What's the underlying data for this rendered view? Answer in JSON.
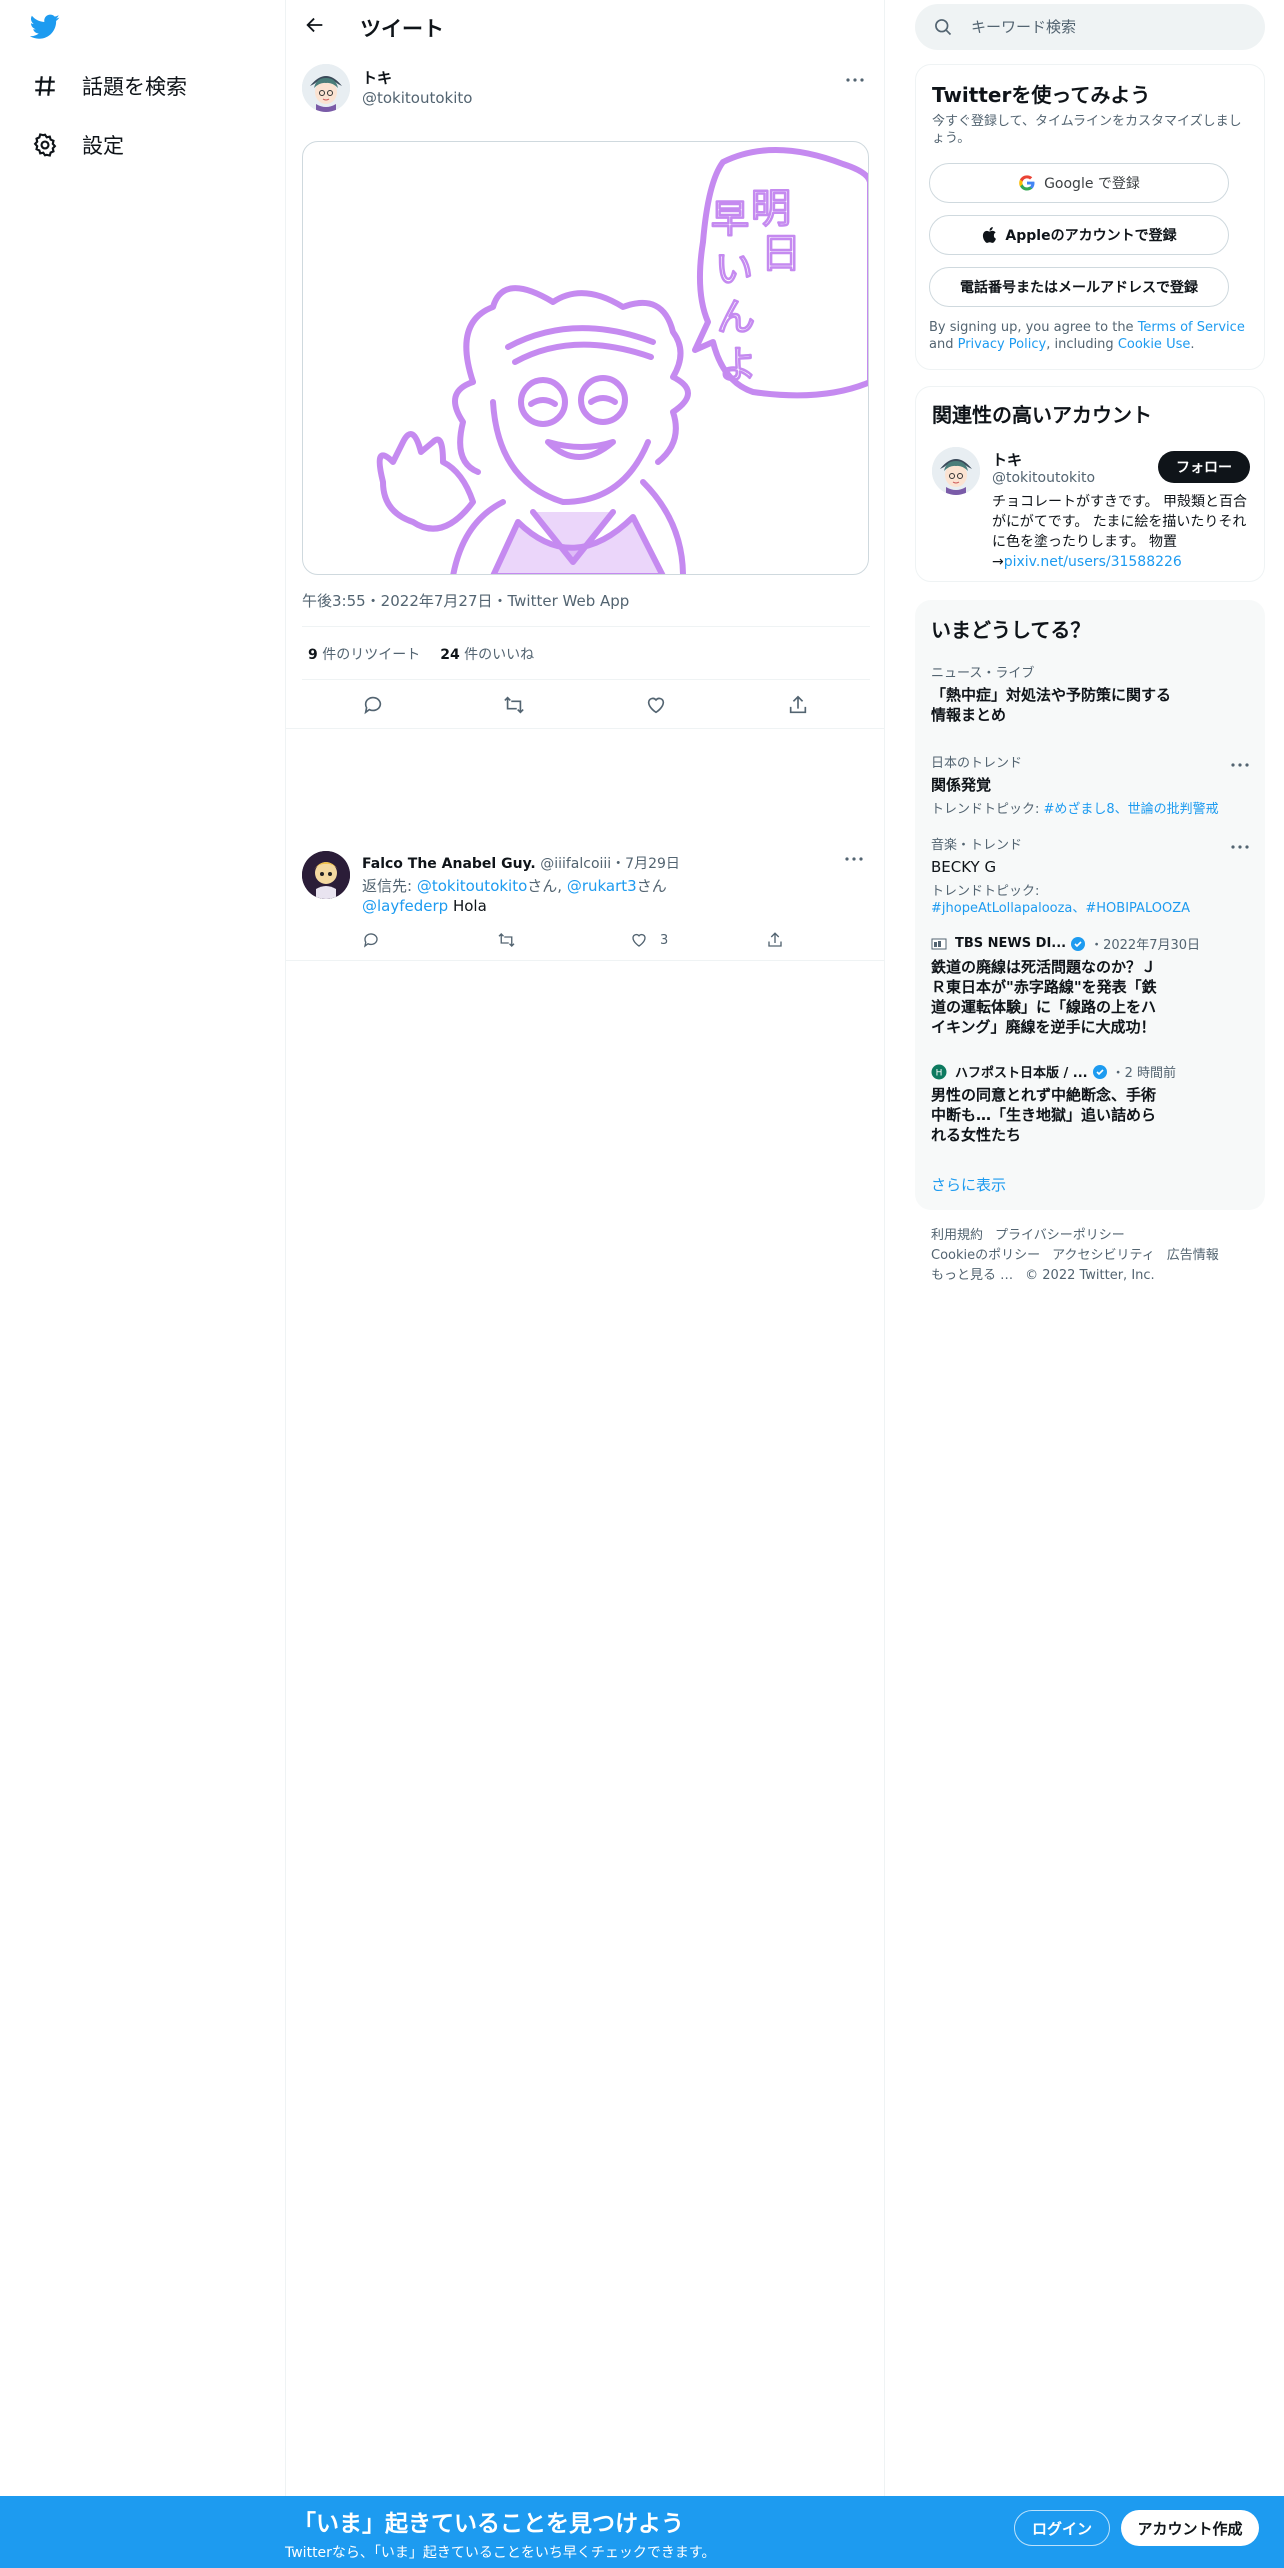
{
  "nav": {
    "logo": "twitter-bird-icon",
    "items": [
      {
        "label": "話題を検索",
        "icon": "hash-icon"
      },
      {
        "label": "設定",
        "icon": "gear-icon"
      }
    ]
  },
  "header": {
    "title": "ツイート"
  },
  "tweet": {
    "name": "トキ",
    "handle": "@tokitoutokito",
    "image_text": "明日早いんよ",
    "timestamp": "午後3:55・2022年7月27日・Twitter Web App",
    "retweets": "9",
    "retweets_label": "件のリツイート",
    "likes": "24",
    "likes_label": "件のいいね"
  },
  "reply": {
    "name": "Falco The Anabel Guy.",
    "handle": "@iiifalcoiii",
    "date": "・7月29日",
    "reply_prefix": "返信先: ",
    "mention1": "@tokitoutokito",
    "san1": "さん, ",
    "mention2": "@rukart3",
    "san2": "さん",
    "mention3": "@layfederp",
    "text": " Hola",
    "likes": "3"
  },
  "search": {
    "placeholder": "キーワード検索"
  },
  "signup": {
    "title": "Twitterを使ってみよう",
    "subtitle": "今すぐ登録して、タイムラインをカスタマイズしましょう。",
    "google": "Google で登録",
    "apple": "Appleのアカウントで登録",
    "phone": "電話番号またはメールアドレスで登録",
    "terms_pre": "By signing up, you agree to the ",
    "terms_tos": "Terms of Service",
    "terms_and": " and ",
    "terms_pp": "Privacy Policy",
    "terms_inc": ", including ",
    "terms_cookie": "Cookie Use",
    "terms_end": "."
  },
  "related": {
    "title": "関連性の高いアカウント",
    "name": "トキ",
    "handle": "@tokitoutokito",
    "follow": "フォロー",
    "bio": "チョコレートがすきです。 甲殻類と百合がにがてです。 たまに絵を描いたりそれに色を塗ったりします。 物置→",
    "bio_link": "pixiv.net/users/31588226"
  },
  "trends": {
    "title": "いまどうしてる？",
    "items": [
      {
        "meta": "ニュース・ライブ",
        "name": "「熱中症」対処法や予防策に関する情報まとめ"
      },
      {
        "meta": "日本のトレンド",
        "name": "関係発覚",
        "topic_label": "トレンドトピック: ",
        "topic": "#めざまし8、世論の批判警戒"
      },
      {
        "meta": "音楽・トレンド",
        "name": "BECKY G",
        "topic_label": "トレンドトピック: ",
        "topic": "#jhopeAtLollapalooza、#HOBIPALOOZA"
      },
      {
        "source": "TBS NEWS DI...",
        "time": "・2022年7月30日",
        "name": "鉄道の廃線は死活問題なのか？ＪＲ東日本が\"赤字路線\"を発表「鉄道の運転体験」に「線路の上をハイキング」廃線を逆手に大成功！"
      },
      {
        "source": "ハフポスト日本版 / ...",
        "time": "・2 時間前",
        "name": "男性の同意とれず中絶断念、手術中断も…「生き地獄」追い詰められる女性たち"
      }
    ],
    "show_more": "さらに表示"
  },
  "footer": {
    "links": [
      "利用規約",
      "プライバシーポリシー",
      "Cookieのポリシー",
      "アクセシビリティ",
      "広告情報",
      "もっと見る …"
    ],
    "copyright": "© 2022 Twitter, Inc."
  },
  "bottombar": {
    "headline": "「いま」起きていることを見つけよう",
    "sub": "Twitterなら、「いま」起きていることをいち早くチェックできます。",
    "login": "ログイン",
    "signup": "アカウント作成"
  },
  "colors": {
    "accent": "#1d9bf0",
    "text": "#0f1419",
    "muted": "#536471",
    "border": "#eff3f4",
    "sketch": "#c58af0"
  }
}
